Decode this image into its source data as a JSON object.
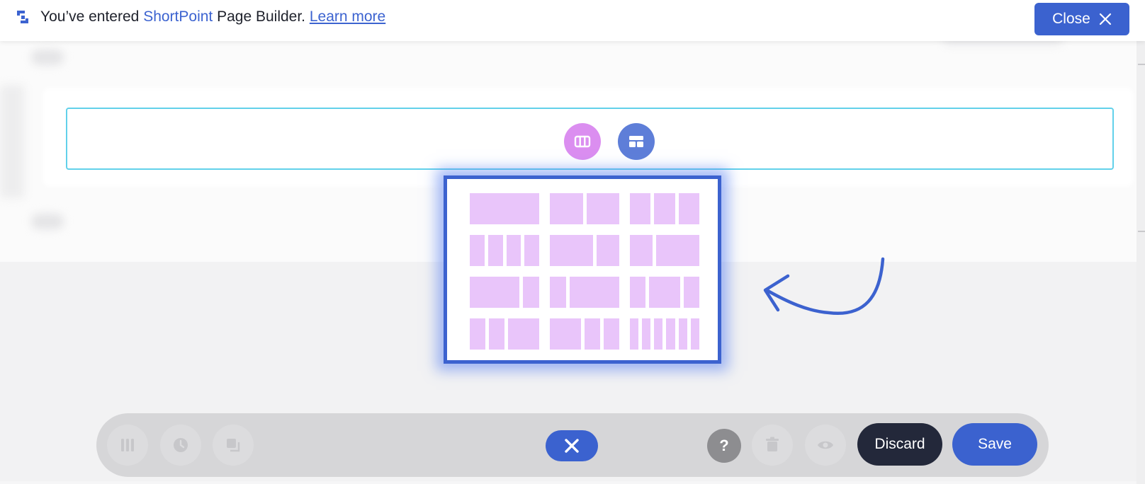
{
  "notice": {
    "prefix": "You’ve entered ",
    "brand": "ShortPoint",
    "suffix": " Page Builder. ",
    "learn_more": "Learn more"
  },
  "close_button": {
    "label": "Close"
  },
  "layout_picker": {
    "options": [
      [
        1
      ],
      [
        1,
        1
      ],
      [
        1,
        1,
        1
      ],
      [
        1,
        1,
        1,
        1
      ],
      [
        3,
        1.6
      ],
      [
        1.6,
        3
      ],
      [
        3,
        1
      ],
      [
        1,
        3
      ],
      [
        1,
        2,
        1
      ],
      [
        1,
        1,
        2
      ],
      [
        2,
        1,
        1
      ],
      [
        1,
        1,
        1,
        1,
        1,
        1
      ]
    ]
  },
  "toolbar": {
    "help_label": "?",
    "discard_label": "Discard",
    "save_label": "Save"
  },
  "colors": {
    "accent": "#3b62cf",
    "row_border": "#62d1ea",
    "layout_cell": "#e9c5fa",
    "columns_button": "#db8ef0",
    "dark_button": "#23283a"
  },
  "icons": {
    "logo": "shortpoint-logo-icon",
    "close": "close-icon",
    "columns": "columns-icon",
    "layout": "layout-icon",
    "arrow": "curved-arrow-icon",
    "history": "clock-icon",
    "copy": "copy-icon",
    "delete": "trash-icon",
    "preview": "eye-icon",
    "cancel": "close-icon"
  }
}
